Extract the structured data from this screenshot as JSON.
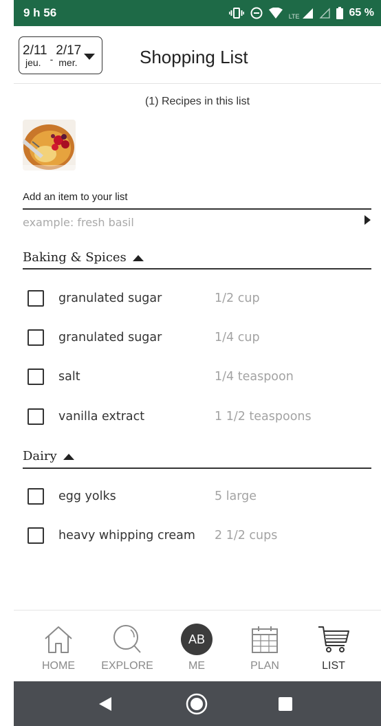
{
  "status_bar": {
    "time": "9 h 56",
    "network": "LTE",
    "battery": "65 %"
  },
  "header": {
    "date_start": "2/11",
    "date_start_day": "jeu.",
    "date_separator": "-",
    "date_end": "2/17",
    "date_end_day": "mer.",
    "title": "Shopping List"
  },
  "recipes_count": "(1) Recipes in this list",
  "add_item": {
    "label": "Add an item to your list",
    "placeholder": "example: fresh basil"
  },
  "sections": [
    {
      "title": "Baking & Spices",
      "items": [
        {
          "name": "granulated sugar",
          "quantity": "1/2 cup"
        },
        {
          "name": "granulated sugar",
          "quantity": "1/4 cup"
        },
        {
          "name": "salt",
          "quantity": "1/4 teaspoon"
        },
        {
          "name": "vanilla extract",
          "quantity": "1 1/2 teaspoons"
        }
      ]
    },
    {
      "title": "Dairy",
      "items": [
        {
          "name": "egg yolks",
          "quantity": "5 large"
        },
        {
          "name": "heavy whipping cream",
          "quantity": "2 1/2 cups"
        }
      ]
    }
  ],
  "bottom_nav": {
    "home": "HOME",
    "explore": "EXPLORE",
    "me": "ME",
    "avatar_initials": "AB",
    "plan": "PLAN",
    "list": "LIST",
    "active": "list"
  },
  "colors": {
    "status_bar": "#1e6a47",
    "system_nav": "#4a4d52",
    "avatar": "#3c3c3c",
    "quantity_text": "#a3a3a3"
  }
}
